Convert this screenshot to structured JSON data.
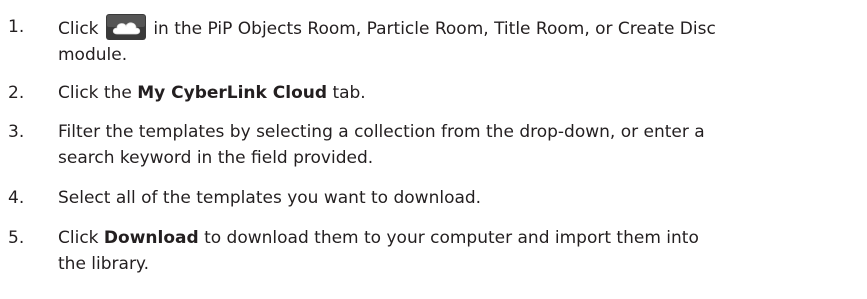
{
  "steps": [
    {
      "number": "1.",
      "prefix": "Click",
      "icon": "cloud-icon",
      "suffix": "in the PiP Objects Room, Particle Room, Title Room, or Create Disc",
      "line2": "module."
    },
    {
      "number": "2.",
      "prefix": "Click the",
      "bold": "My CyberLink Cloud",
      "suffix": "tab."
    },
    {
      "number": "3.",
      "line1": "Filter the templates by selecting a collection from the drop-down, or enter a",
      "line2": "search keyword in the field provided."
    },
    {
      "number": "4.",
      "line1": "Select all of the templates you want to download."
    },
    {
      "number": "5.",
      "prefix": "Click",
      "bold": "Download",
      "suffix": "to download them to your computer and import them into",
      "line2": "the library."
    }
  ],
  "colors": {
    "text": "#231f20",
    "icon_dark": "#3a3a3a",
    "icon_cloud": "#ffffff"
  }
}
